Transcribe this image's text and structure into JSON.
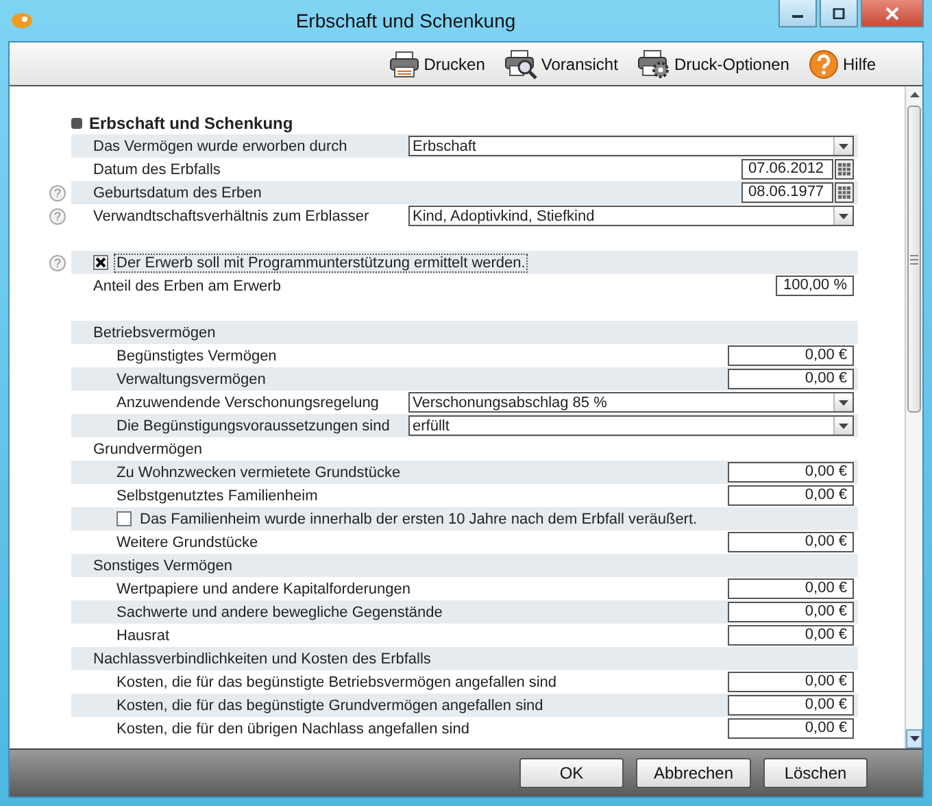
{
  "window": {
    "title": "Erbschaft und Schenkung"
  },
  "toolbar": [
    {
      "label": "Drucken"
    },
    {
      "label": "Voransicht"
    },
    {
      "label": "Druck-Optionen"
    },
    {
      "label": "Hilfe"
    }
  ],
  "form": {
    "title": "Erbschaft und Schenkung",
    "rows": [
      {
        "kind": "select",
        "label": "Das Vermögen wurde erworben durch",
        "value": "Erbschaft"
      },
      {
        "kind": "date",
        "label": "Datum des Erbfalls",
        "value": "07.06.2012"
      },
      {
        "kind": "date",
        "label": "Geburtsdatum des Erben",
        "value": "08.06.1977",
        "help": "?"
      },
      {
        "kind": "select",
        "label": "Verwandtschaftsverhältnis zum Erblasser",
        "value": "Kind, Adoptivkind, Stiefkind",
        "help": "?"
      },
      {
        "kind": "spacer"
      },
      {
        "kind": "checkbox",
        "label": "Der Erwerb soll mit Programmunterstützung ermittelt werden.",
        "checked": true,
        "focused": true,
        "help": "?"
      },
      {
        "kind": "percent",
        "label": "Anteil des Erben am Erwerb",
        "value": "100,00 %"
      },
      {
        "kind": "spacer"
      },
      {
        "kind": "group",
        "label": "Betriebsvermögen",
        "children": [
          {
            "kind": "amount",
            "label": "Begünstigtes Vermögen",
            "value": "0,00 €"
          },
          {
            "kind": "amount",
            "label": "Verwaltungsvermögen",
            "value": "0,00 €"
          },
          {
            "kind": "select",
            "label": "Anzuwendende Verschonungsregelung",
            "value": "Verschonungsabschlag 85 %"
          },
          {
            "kind": "select",
            "label": "Die Begünstigungsvoraussetzungen sind",
            "value": "erfüllt"
          }
        ]
      },
      {
        "kind": "group",
        "label": "Grundvermögen",
        "children": [
          {
            "kind": "amount",
            "label": "Zu Wohnzwecken vermietete Grundstücke",
            "value": "0,00 €"
          },
          {
            "kind": "amount",
            "label": "Selbstgenutztes Familienheim",
            "value": "0,00 €"
          },
          {
            "kind": "checkbox",
            "label": "Das Familienheim wurde innerhalb der ersten 10 Jahre nach dem Erbfall veräußert.",
            "checked": false,
            "focused": false
          },
          {
            "kind": "amount",
            "label": "Weitere Grundstücke",
            "value": "0,00 €"
          }
        ]
      },
      {
        "kind": "group",
        "label": "Sonstiges Vermögen",
        "children": [
          {
            "kind": "amount",
            "label": "Wertpapiere und andere Kapitalforderungen",
            "value": "0,00 €"
          },
          {
            "kind": "amount",
            "label": "Sachwerte und andere bewegliche Gegenstände",
            "value": "0,00 €"
          },
          {
            "kind": "amount",
            "label": "Hausrat",
            "value": "0,00 €"
          }
        ]
      },
      {
        "kind": "group",
        "label": "Nachlassverbindlichkeiten und Kosten des Erbfalls",
        "children": [
          {
            "kind": "amount",
            "label": "Kosten, die für das begünstigte Betriebsvermögen angefallen sind",
            "value": "0,00 €"
          },
          {
            "kind": "amount",
            "label": "Kosten, die für das begünstigte Grundvermögen angefallen sind",
            "value": "0,00 €"
          },
          {
            "kind": "amount",
            "label": "Kosten, die für den übrigen Nachlass angefallen sind",
            "value": "0,00 €"
          }
        ]
      }
    ]
  },
  "buttons": [
    "OK",
    "Abbrechen",
    "Löschen"
  ]
}
